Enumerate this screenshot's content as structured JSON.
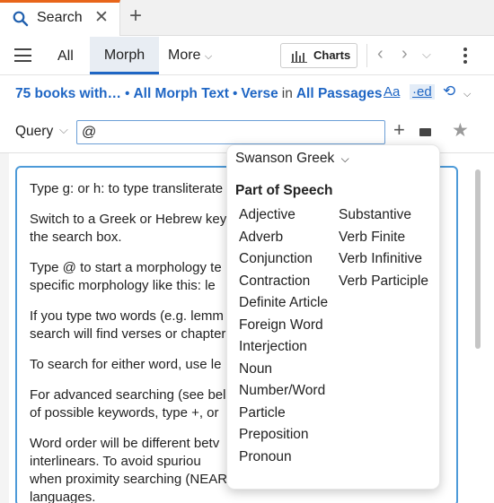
{
  "tab": {
    "label": "Search"
  },
  "toolbar": {
    "views": [
      "All",
      "Morph",
      "More"
    ],
    "charts_label": "Charts"
  },
  "scope": {
    "books": "75 books with…",
    "text": "All Morph Text",
    "unit": "Verse",
    "in_word": "in",
    "passages": "All Passages",
    "font_label": "Aa",
    "ed_label": "·ed"
  },
  "query": {
    "label": "Query",
    "value": "@"
  },
  "help": [
    "Type g: or h: to type transliterate",
    "Switch to a Greek or Hebrew key",
    "the search box.",
    "Type @ to start a morphology te",
    "specific morphology like this: le",
    "If you type two words (e.g. lemm",
    "search will find verses or chapter",
    "To search for either word, use le",
    "For advanced searching (see bel",
    "of possible keywords, type +, or",
    "Word order will be different betv",
    "interlinears. To avoid spuriou",
    "when proximity searching (NEAR",
    "languages."
  ],
  "dropdown": {
    "source": "Swanson Greek",
    "section": "Part of Speech",
    "col1": [
      "Adjective",
      "Adverb",
      "Conjunction",
      "Contraction",
      "Definite Article",
      "Foreign Word",
      "Interjection",
      "Noun",
      "Number/Word",
      "Particle",
      "Preposition",
      "Pronoun"
    ],
    "col2": [
      "Substantive",
      "Verb Finite",
      "Verb Infinitive",
      "Verb Participle"
    ]
  },
  "colors": {
    "accent": "#1f66c4",
    "tab_accent": "#e8651a",
    "focus": "#4d9ad8"
  },
  "icons": [
    "search-icon",
    "close-icon",
    "plus-icon",
    "menu-icon",
    "chevron-down-icon",
    "bar-chart-icon",
    "chevron-left-icon",
    "chevron-right-icon",
    "more-vertical-icon",
    "keyboard-icon",
    "star-icon"
  ]
}
